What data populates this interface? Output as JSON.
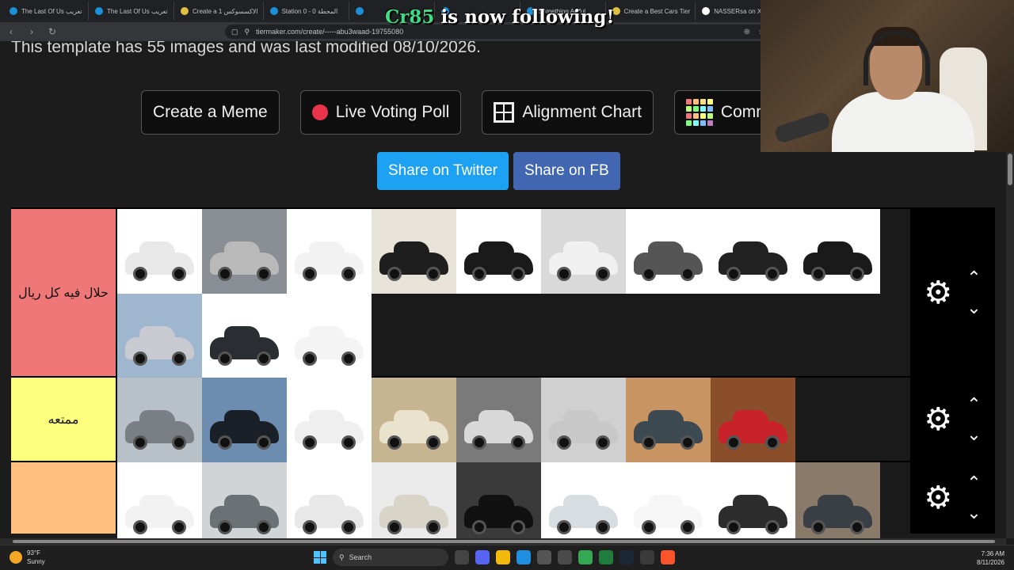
{
  "browser": {
    "tabs": [
      {
        "label": "The Last Of Us تعريب",
        "color": "#1b8fd8"
      },
      {
        "label": "The Last Of Us تعريب",
        "color": "#1b8fd8"
      },
      {
        "label": "Create a الاكسسوكس 1",
        "color": "#e0c040"
      },
      {
        "label": "Station 0 - 0 المحطة",
        "color": "#1b8fd8"
      },
      {
        "label": "",
        "color": "#1b8fd8"
      },
      {
        "label": "",
        "color": "#1b8fd8"
      },
      {
        "label": "Something Awful",
        "color": "#1b8fd8"
      },
      {
        "label": "Create a Best Cars Tier",
        "color": "#e0c040"
      },
      {
        "label": "NASSERsa on X: \"@3",
        "color": "#ffffff"
      },
      {
        "label": "Create a",
        "color": "#e0c040",
        "active": true
      }
    ],
    "url": "tiermaker.com/create/-----abu3waad-19755080"
  },
  "page": {
    "template_info": "This template has 55 images and was last modified 08/10/2026.",
    "buttons": {
      "meme": "Create a Meme",
      "poll": "Live Voting Poll",
      "alignment": "Alignment Chart",
      "community": "Comm"
    },
    "share": {
      "twitter": "Share on Twitter",
      "fb": "Share on FB"
    }
  },
  "tiers": [
    {
      "label": "حلال فيه كل ريال",
      "color": "#f07777",
      "cars": [
        {
          "bg": "#ffffff",
          "body": "#e8e8e8"
        },
        {
          "bg": "#8a8f96",
          "body": "#b9b9b9"
        },
        {
          "bg": "#ffffff",
          "body": "#f2f2f2"
        },
        {
          "bg": "#e8e3d8",
          "body": "#1e1e1e"
        },
        {
          "bg": "#ffffff",
          "body": "#1a1a1a"
        },
        {
          "bg": "#d9d9d9",
          "body": "#f0f0f0"
        },
        {
          "bg": "#ffffff",
          "body": "#555555"
        },
        {
          "bg": "#ffffff",
          "body": "#222222"
        },
        {
          "bg": "#ffffff",
          "body": "#1a1a1a"
        },
        {
          "bg": "#9fb6cf",
          "body": "#c9c9d2"
        },
        {
          "bg": "#ffffff",
          "body": "#2a2e33"
        },
        {
          "bg": "#ffffff",
          "body": "#f4f4f4"
        }
      ]
    },
    {
      "label": "ممتعه",
      "color": "#ffff7f",
      "cars": [
        {
          "bg": "#b8c0c8",
          "body": "#7a7f85"
        },
        {
          "bg": "#6c8cb0",
          "body": "#1a1f28"
        },
        {
          "bg": "#ffffff",
          "body": "#efefef"
        },
        {
          "bg": "#c6b590",
          "body": "#e9e2cc"
        },
        {
          "bg": "#7a7a7a",
          "body": "#d8d8d8"
        },
        {
          "bg": "#d0d0d0",
          "body": "#c8c8c8"
        },
        {
          "bg": "#c89462",
          "body": "#3e4a52"
        },
        {
          "bg": "#8a4e2a",
          "body": "#c8232a"
        }
      ]
    },
    {
      "label": "",
      "color": "#ffbf7f",
      "cars": [
        {
          "bg": "#ffffff",
          "body": "#f2f2f2"
        },
        {
          "bg": "#d0d4d6",
          "body": "#6b7276"
        },
        {
          "bg": "#ffffff",
          "body": "#e8e8e8"
        },
        {
          "bg": "#eaeaea",
          "body": "#d8d4c8"
        },
        {
          "bg": "#3a3a3a",
          "body": "#111111"
        },
        {
          "bg": "#ffffff",
          "body": "#d8dde2"
        },
        {
          "bg": "#ffffff",
          "body": "#f6f6f6"
        },
        {
          "bg": "#ffffff",
          "body": "#2c2c2c"
        },
        {
          "bg": "#8a7a6a",
          "body": "#3a3f46"
        }
      ]
    }
  ],
  "overlay": {
    "follower_name": "Cr85",
    "follow_text": " is now following!"
  },
  "taskbar": {
    "temp": "93°F",
    "weather": "Sunny",
    "search": "Search",
    "time": "7:36 AM",
    "date": "8/11/2026",
    "apps": [
      "#444",
      "#5865f2",
      "#f2b90c",
      "#1f8fe0",
      "#555",
      "#4a4a4a",
      "#34a853",
      "#1e7d3a",
      "#1b2838",
      "#3a3a3a",
      "#fb542b"
    ]
  }
}
